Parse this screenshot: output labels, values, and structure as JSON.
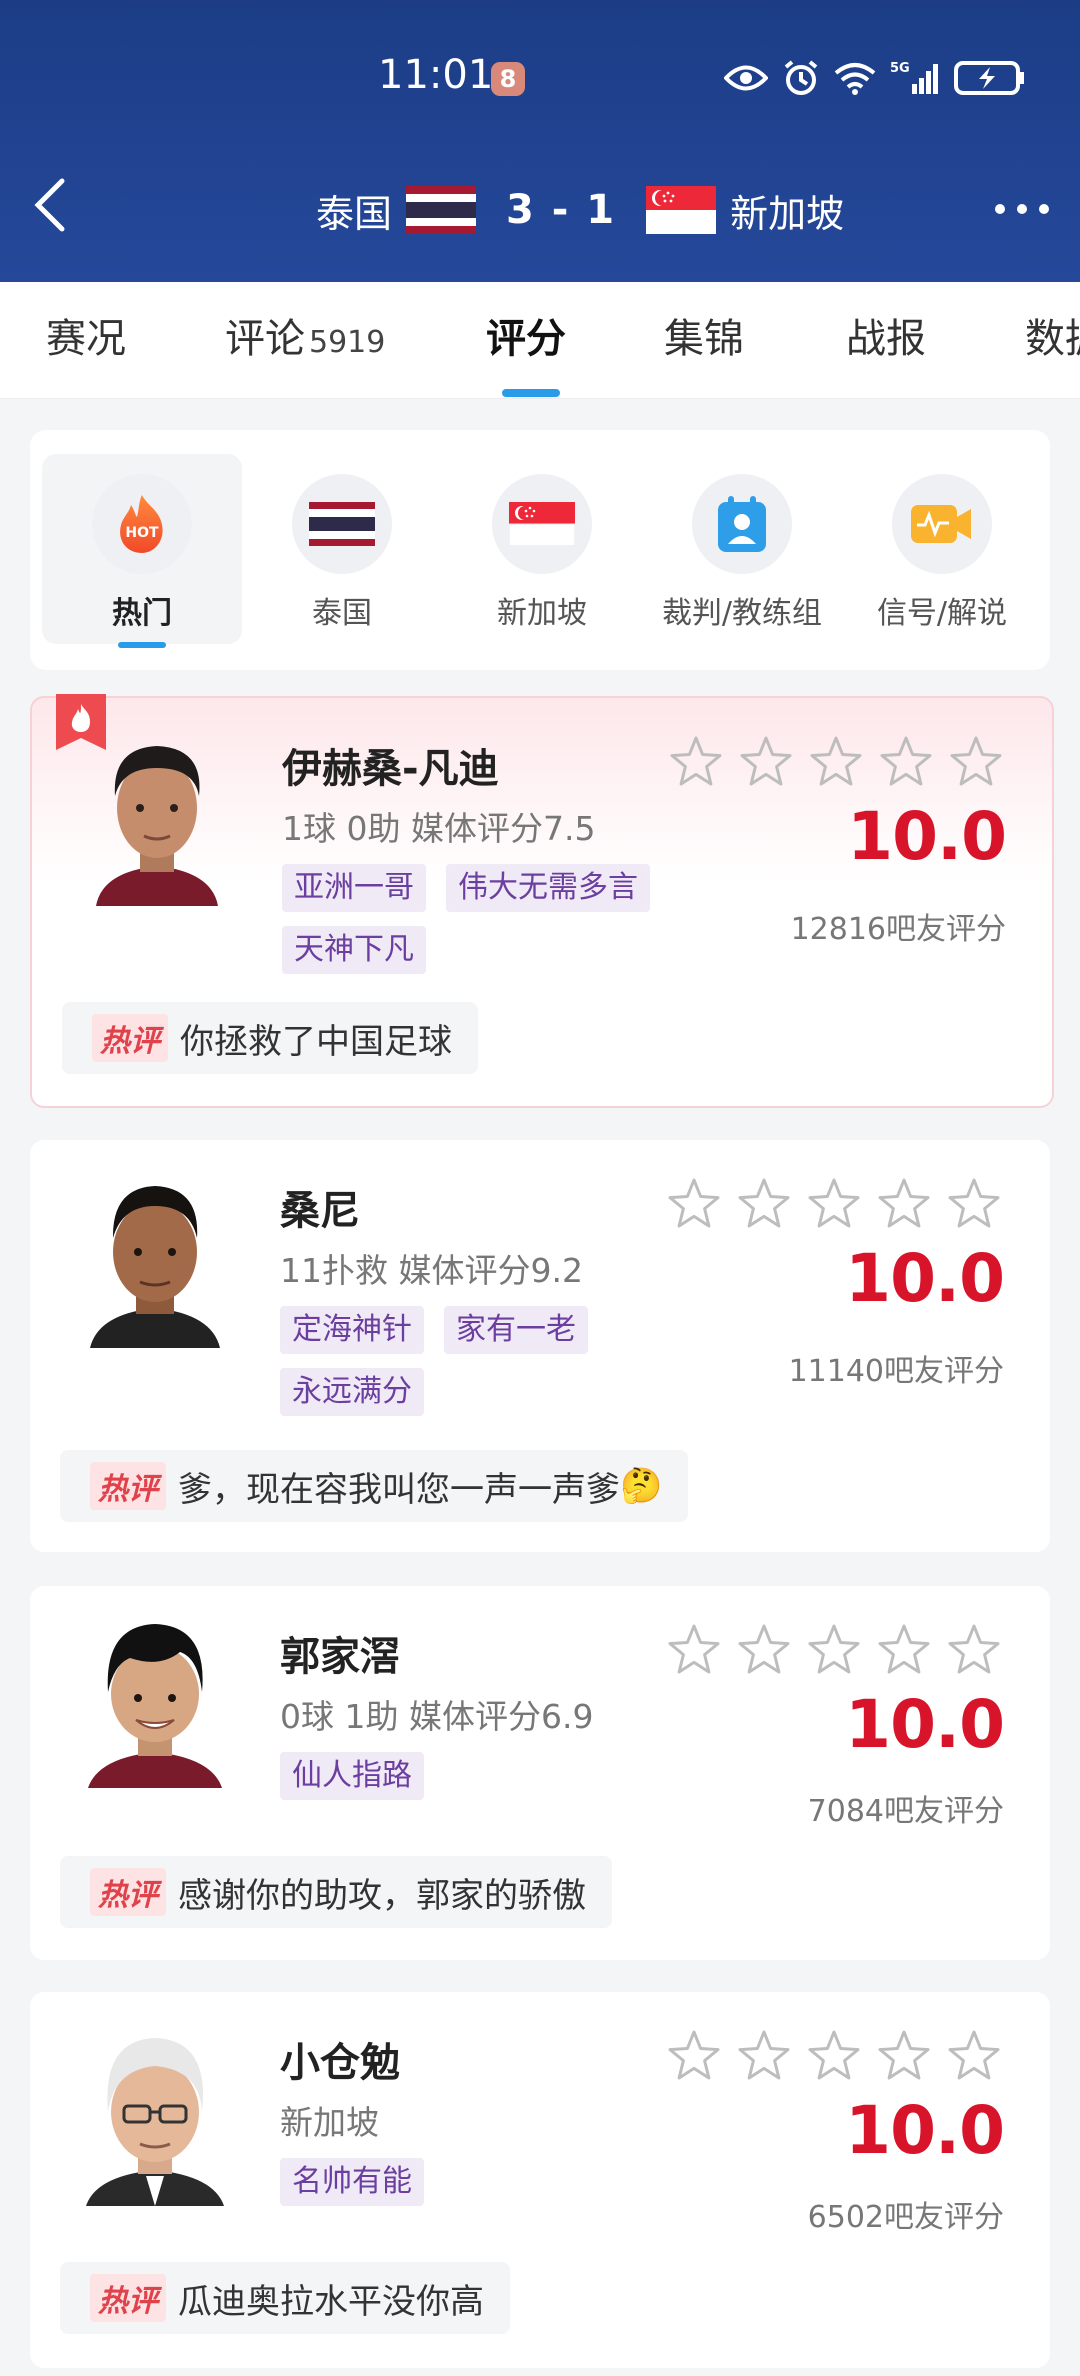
{
  "status_bar": {
    "time": "11:01",
    "badge": "8",
    "icons": [
      "eye-icon",
      "alarm-icon",
      "wifi-icon",
      "signal-5g-icon",
      "battery-charging-icon"
    ],
    "net_label": "5G"
  },
  "header": {
    "home_team": "泰国",
    "away_team": "新加坡",
    "score": "3 - 1",
    "back_icon": "back-arrow-icon",
    "more_icon": "more-dots-icon"
  },
  "tabs": [
    {
      "label": "赛况",
      "count": ""
    },
    {
      "label": "评论",
      "count": "5919"
    },
    {
      "label": "评分",
      "count": "",
      "active": true
    },
    {
      "label": "集锦",
      "count": ""
    },
    {
      "label": "战报",
      "count": ""
    },
    {
      "label": "数据",
      "count": ""
    }
  ],
  "filters": [
    {
      "label": "热门",
      "icon": "hot-icon",
      "icon_text": "HOT",
      "active": true
    },
    {
      "label": "泰国",
      "icon": "thailand-flag-icon"
    },
    {
      "label": "新加坡",
      "icon": "singapore-flag-icon"
    },
    {
      "label": "裁判/教练组",
      "icon": "referee-icon"
    },
    {
      "label": "信号/解说",
      "icon": "broadcast-icon"
    }
  ],
  "players": [
    {
      "name": "伊赫桑-凡迪",
      "stat": "1球 0助  媒体评分7.5",
      "tags": [
        "亚洲一哥",
        "伟大无需多言",
        "天神下凡"
      ],
      "rating": "10.0",
      "rating_count": "12816吧友评分",
      "hot_label": "热评",
      "comment": "你拯救了中国足球",
      "comment_emoji": "",
      "hot": true
    },
    {
      "name": "桑尼",
      "stat": "11扑救  媒体评分9.2",
      "tags": [
        "定海神针",
        "家有一老",
        "永远满分"
      ],
      "rating": "10.0",
      "rating_count": "11140吧友评分",
      "hot_label": "热评",
      "comment": "爹，现在容我叫您一声一声爹",
      "comment_emoji": "🤔"
    },
    {
      "name": "郭家滘",
      "stat": "0球 1助  媒体评分6.9",
      "tags": [
        "仙人指路"
      ],
      "rating": "10.0",
      "rating_count": "7084吧友评分",
      "hot_label": "热评",
      "comment": "感谢你的助攻，郭家的骄傲",
      "comment_emoji": ""
    },
    {
      "name": "小仓勉",
      "stat": "新加坡",
      "tags": [
        "名帅有能"
      ],
      "rating": "10.0",
      "rating_count": "6502吧友评分",
      "hot_label": "热评",
      "comment": "瓜迪奥拉水平没你高",
      "comment_emoji": ""
    }
  ],
  "colors": {
    "header_bg": "#1f418d",
    "accent_blue": "#2a9be8",
    "rating_red": "#d8142b",
    "tag_purple": "#6b3fa0",
    "hot_red": "#e0424b"
  }
}
